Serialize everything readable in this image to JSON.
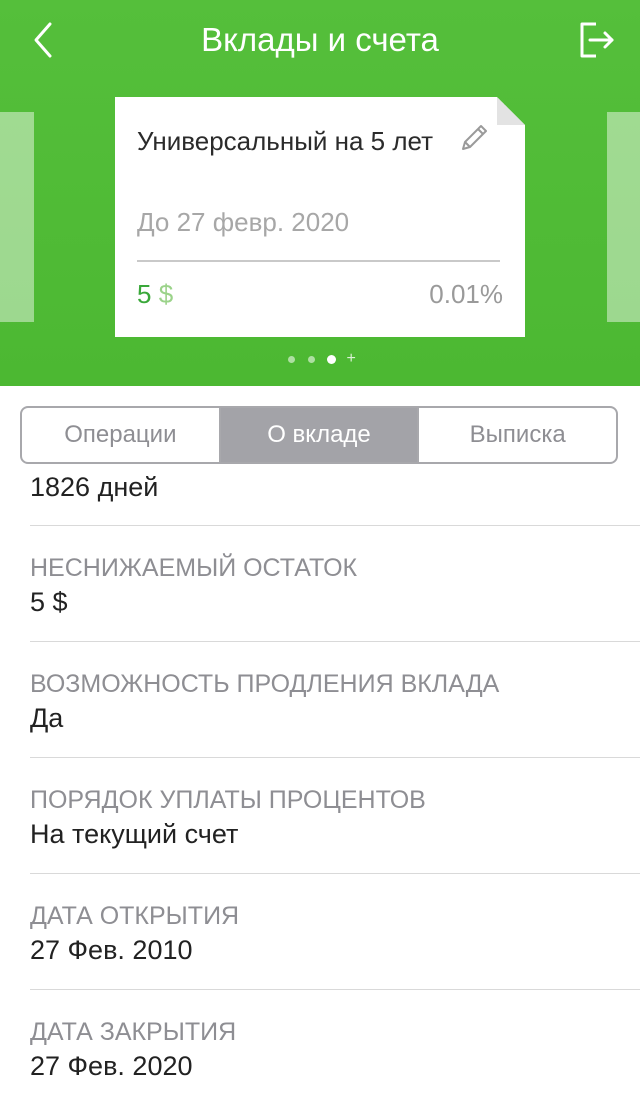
{
  "nav": {
    "title": "Вклады и счета",
    "back_icon": "chevron-left-icon",
    "exit_icon": "logout-icon"
  },
  "card": {
    "name": "Универсальный на 5 лет",
    "date": "До 27 февр. 2020",
    "amount": "5",
    "currency": "$",
    "rate": "0.01%",
    "edit_icon": "pencil-icon"
  },
  "pager": {
    "count": 3,
    "active_index": 2,
    "add_symbol": "+"
  },
  "tabs": [
    {
      "label": "Операции"
    },
    {
      "label": "О вкладе",
      "active": true
    },
    {
      "label": "Выписка"
    }
  ],
  "details": {
    "term_value": "1826 дней",
    "fields": [
      {
        "label": "НЕСНИЖАЕМЫЙ ОСТАТОК",
        "value": "5 $"
      },
      {
        "label": "ВОЗМОЖНОСТЬ ПРОДЛЕНИЯ ВКЛАДА",
        "value": "Да"
      },
      {
        "label": "ПОРЯДОК УПЛАТЫ ПРОЦЕНТОВ",
        "value": "На текущий счет"
      },
      {
        "label": "ДАТА ОТКРЫТИЯ",
        "value": "27 Фев. 2010"
      },
      {
        "label": "ДАТА ЗАКРЫТИЯ",
        "value": "27 Фев. 2020"
      }
    ]
  },
  "colors": {
    "brand_green": "#4cb832",
    "amount_green": "#3aa83a",
    "segment_active": "#a3a3a8"
  }
}
